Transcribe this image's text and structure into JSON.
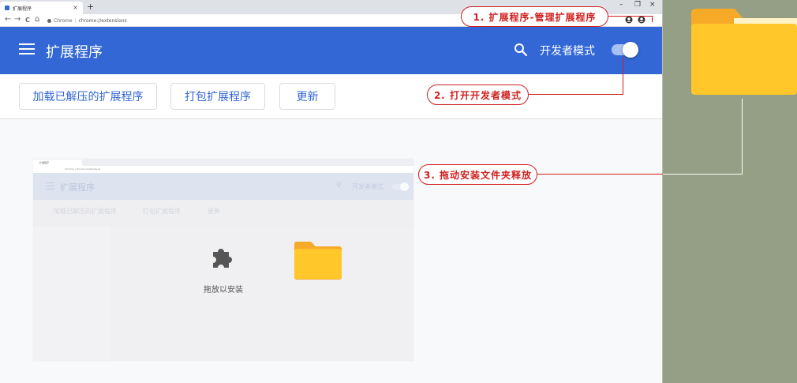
{
  "browser": {
    "tab_title": "扩展程序",
    "tab_close": "×",
    "new_tab": "+",
    "window_minimize": "–",
    "window_restore": "❐",
    "window_close": "×",
    "nav_back": "←",
    "nav_forward": "→",
    "nav_reload": "C",
    "nav_home": "⌂",
    "site_label": "Chrome",
    "url": "chrome://extensions",
    "menu_icon": "⋮"
  },
  "appbar": {
    "title": "扩展程序",
    "developer_mode_label": "开发者模式",
    "developer_mode_on": true,
    "color": "#3367d6"
  },
  "actions": {
    "load_unpacked": "加载已解压的扩展程序",
    "pack_extension": "打包扩展程序",
    "update": "更新"
  },
  "inner_screenshot": {
    "tab_title": "扩展程序",
    "url": "Chrome | chrome://extensions",
    "title": "扩展程序",
    "developer_mode_label": "开发者模式",
    "load_unpacked": "加载已解压的扩展程序",
    "pack_extension": "打包扩展程序",
    "update": "更新",
    "drop_text": "拖放以安装"
  },
  "annotations": {
    "step1": "1. 扩展程序-管理扩展程序",
    "step2": "2. 打开开发者模式",
    "step3": "3. 拖动安装文件夹释放",
    "color": "#d02020"
  },
  "icons": {
    "folder_color": "#ffc72a",
    "puzzle_color": "#555555"
  }
}
